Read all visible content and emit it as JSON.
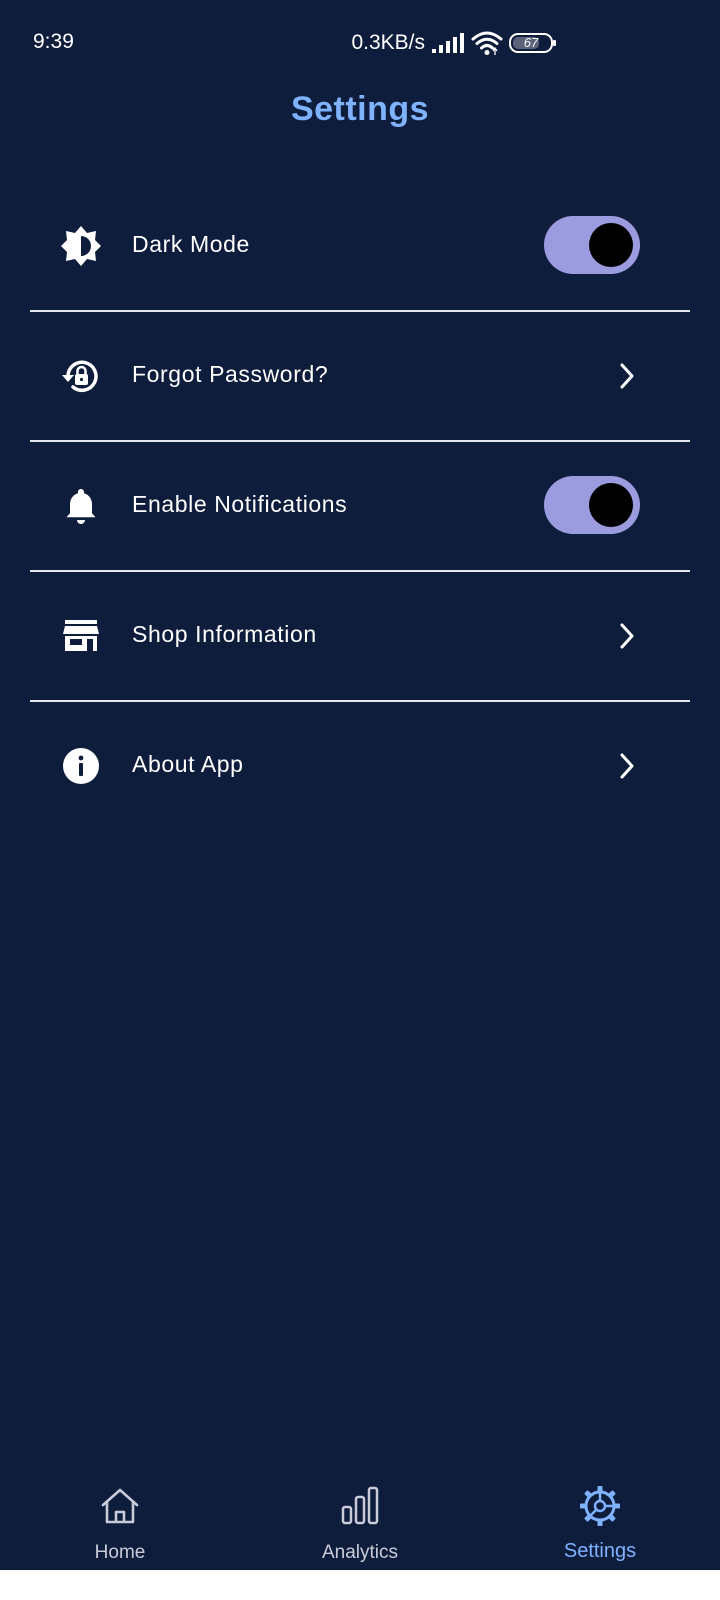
{
  "status_bar": {
    "time": "9:39",
    "network_speed": "0.3KB/s",
    "battery_level": "67",
    "signal_icon": "cellular-signal-icon",
    "wifi_icon": "wifi-icon"
  },
  "header": {
    "title": "Settings"
  },
  "settings": {
    "items": [
      {
        "label": "Dark Mode",
        "icon": "brightness-contrast-icon",
        "control": "toggle",
        "on": true
      },
      {
        "label": "Forgot Password?",
        "icon": "lock-reset-icon",
        "control": "chevron"
      },
      {
        "label": "Enable Notifications",
        "icon": "bell-icon",
        "control": "toggle",
        "on": true
      },
      {
        "label": "Shop Information",
        "icon": "store-icon",
        "control": "chevron"
      },
      {
        "label": "About App",
        "icon": "info-icon",
        "control": "chevron"
      }
    ]
  },
  "bottom_nav": {
    "items": [
      {
        "label": "Home",
        "icon": "home-icon",
        "active": false
      },
      {
        "label": "Analytics",
        "icon": "bar-chart-icon",
        "active": false
      },
      {
        "label": "Settings",
        "icon": "gear-icon",
        "active": true
      }
    ]
  },
  "colors": {
    "background": "#0f1d3d",
    "accent": "#7fb2ff",
    "toggle_track": "#9b9be0",
    "divider": "#e6e8ee"
  }
}
